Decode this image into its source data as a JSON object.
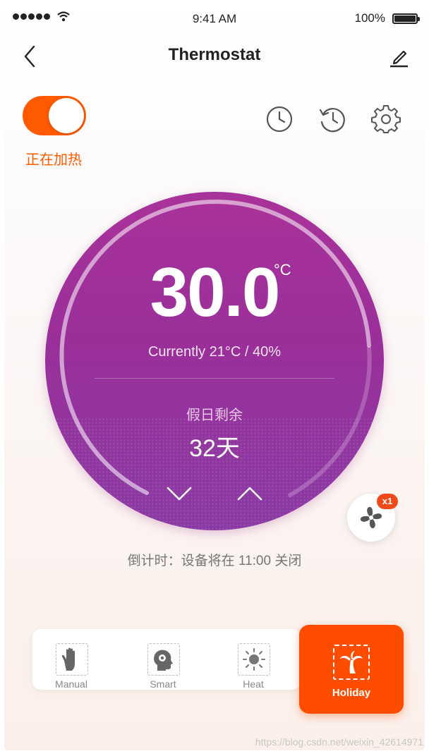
{
  "status_bar": {
    "time": "9:41 AM",
    "battery": "100%"
  },
  "nav": {
    "title": "Thermostat"
  },
  "power": {
    "on": true,
    "status_text": "正在加热"
  },
  "dial": {
    "target_temp": "30.0",
    "unit": "°C",
    "current": "Currently  21°C  /  40%",
    "holiday_label": "假日剩余",
    "holiday_days": "32天"
  },
  "fan": {
    "badge": "x1"
  },
  "countdown": "倒计时：设备将在 11:00 关闭",
  "modes": [
    {
      "label": "Manual",
      "icon": "hand-icon",
      "active": false
    },
    {
      "label": "Smart",
      "icon": "smart-head-icon",
      "active": false
    },
    {
      "label": "Heat",
      "icon": "sun-icon",
      "active": false
    },
    {
      "label": "Holiday",
      "icon": "palm-tree-icon",
      "active": true
    }
  ],
  "watermark": "https://blog.csdn.net/weixin_42614971",
  "colors": {
    "accent": "#ff4d00",
    "dial_top": "#a9329a",
    "dial_bottom": "#8a3aa4"
  }
}
